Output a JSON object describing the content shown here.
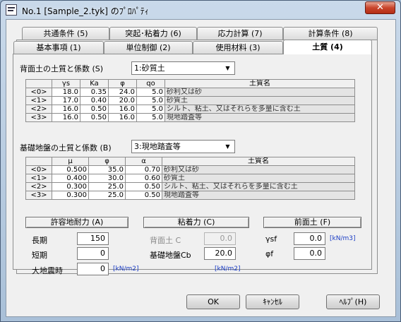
{
  "window": {
    "title": "No.1 [Sample_2.tyk] のﾌﾟﾛﾊﾟﾃｨ",
    "close_label": "✕"
  },
  "tabs": {
    "row_back": [
      "共通条件 (5)",
      "突起･粘着力 (6)",
      "応力計算 (7)",
      "計算条件 (8)"
    ],
    "row_front": [
      "基本事項 (1)",
      "単位制御 (2)",
      "使用材料 (3)",
      "土質 (4)"
    ]
  },
  "back_soil": {
    "label": "背面土の土質と係数 (S)",
    "selected": "1:砂質土",
    "columns": [
      "",
      "γs",
      "Ka",
      "φ",
      "qo",
      "土質名"
    ],
    "rows": [
      {
        "head": "<0>",
        "c1": "18.0",
        "c2": "0.35",
        "c3": "24.0",
        "c4": "5.0",
        "name": "砂利又は砂"
      },
      {
        "head": "<1>",
        "c1": "17.0",
        "c2": "0.40",
        "c3": "20.0",
        "c4": "5.0",
        "name": "砂質土"
      },
      {
        "head": "<2>",
        "c1": "16.0",
        "c2": "0.50",
        "c3": "16.0",
        "c4": "5.0",
        "name": "シルト、粘土、又はそれらを多量に含む土"
      },
      {
        "head": "<3>",
        "c1": "16.0",
        "c2": "0.50",
        "c3": "16.0",
        "c4": "5.0",
        "name": "現地踏査等"
      }
    ]
  },
  "foundation_soil": {
    "label": "基礎地盤の土質と係数 (B)",
    "selected": "3:現地踏査等",
    "columns": [
      "",
      "μ",
      "φ",
      "α",
      "土質名"
    ],
    "rows": [
      {
        "head": "<0>",
        "c1": "0.500",
        "c2": "35.0",
        "c3": "0.70",
        "name": "砂利又は砂"
      },
      {
        "head": "<1>",
        "c1": "0.400",
        "c2": "30.0",
        "c3": "0.60",
        "name": "砂質土"
      },
      {
        "head": "<2>",
        "c1": "0.300",
        "c2": "25.0",
        "c3": "0.50",
        "name": "シルト、粘土、又はそれらを多量に含む土"
      },
      {
        "head": "<3>",
        "c1": "0.300",
        "c2": "25.0",
        "c3": "0.50",
        "name": "現地踏査等"
      }
    ]
  },
  "bearing": {
    "header": "許容地耐力 (A)",
    "long_label": "長期",
    "long_value": "150",
    "short_label": "短期",
    "short_value": "0",
    "quake_label": "大地震時",
    "quake_value": "0",
    "unit": "[kN/m2]"
  },
  "adhesion": {
    "header": "粘着力 (C)",
    "back_label": "背面土 C",
    "back_value": "0.0",
    "base_label": "基礎地盤Cb",
    "base_value": "20.0",
    "unit": "[kN/m2]"
  },
  "front_soil": {
    "header": "前面土 (F)",
    "gamma_label": "γsf",
    "gamma_value": "0.0",
    "gamma_unit": "[kN/m3]",
    "phi_label": "φf",
    "phi_value": "0.0"
  },
  "buttons": {
    "ok": "OK",
    "cancel": "ｷｬﾝｾﾙ",
    "help": "ﾍﾙﾌﾟ(H)"
  }
}
